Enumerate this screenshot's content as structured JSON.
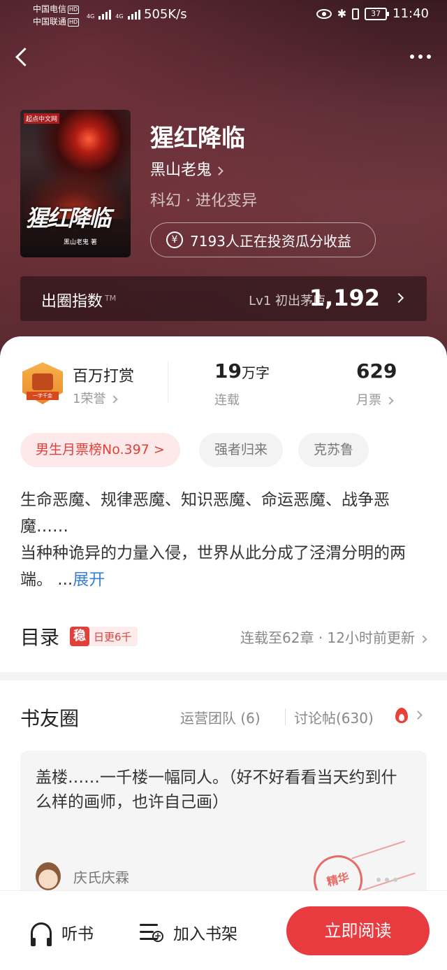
{
  "status_bar": {
    "carrier1": "中国电信",
    "carrier2": "中国联通",
    "hd": "HD",
    "net1": "4G",
    "net2": "4G",
    "speed": "505K/s",
    "battery": "37",
    "time": "11:40",
    "bluetooth_glyph": "✱"
  },
  "book": {
    "title": "猩红降临",
    "author": "黑山老鬼",
    "genre": "科幻 · 进化变异",
    "invest_text": "7193人正在投资瓜分收益",
    "yen_symbol": "¥",
    "cover": {
      "publisher_tag": "起点中文网",
      "title_art": "猩红降临",
      "author_tag": "黑山老鬼 著"
    }
  },
  "index": {
    "label": "出圈指数",
    "tm": "TM",
    "level_text": "Lv1 初出茅庐",
    "value": "1,192"
  },
  "stats": {
    "reward_title": "百万打赏",
    "reward_sub": "1荣誉",
    "badge_ribbon": "一字千金",
    "words_value": "19",
    "words_unit": "万字",
    "words_label": "连载",
    "votes_value": "629",
    "votes_label": "月票"
  },
  "tags": [
    "男生月票榜No.397 >",
    "强者归来",
    "克苏鲁"
  ],
  "synopsis": {
    "text": "生命恶魔、规律恶魔、知识恶魔、命运恶魔、战争恶魔……\n当种种诡异的力量入侵，世界从此分成了泾渭分明的两端。 ...",
    "expand": "展开"
  },
  "toc": {
    "title": "目录",
    "badge_icon": "稳",
    "badge_text": "日更6千",
    "status": "连载至62章 · 12小时前更新"
  },
  "circle": {
    "title": "书友圈",
    "ops": "运营团队 (6)",
    "posts": "讨论帖(630)",
    "post_text": "盖楼……一千楼一幅同人。（好不好看看当天约到什么样的画师，也许自己画）",
    "post_user": "庆氏庆霖",
    "stamp": "精华"
  },
  "bottom_bar": {
    "listen": "听书",
    "shelf": "加入书架",
    "read": "立即阅读"
  },
  "colors": {
    "accent": "#e83b40",
    "link": "#3b7fd6",
    "hero": "#5b2a33"
  },
  "icons": [
    "back-icon",
    "more-icon",
    "eye-icon",
    "bluetooth-icon",
    "vibrate-icon",
    "battery-icon",
    "yen-icon",
    "chevron-right-icon",
    "fire-icon",
    "headphone-icon",
    "bookshelf-add-icon"
  ]
}
